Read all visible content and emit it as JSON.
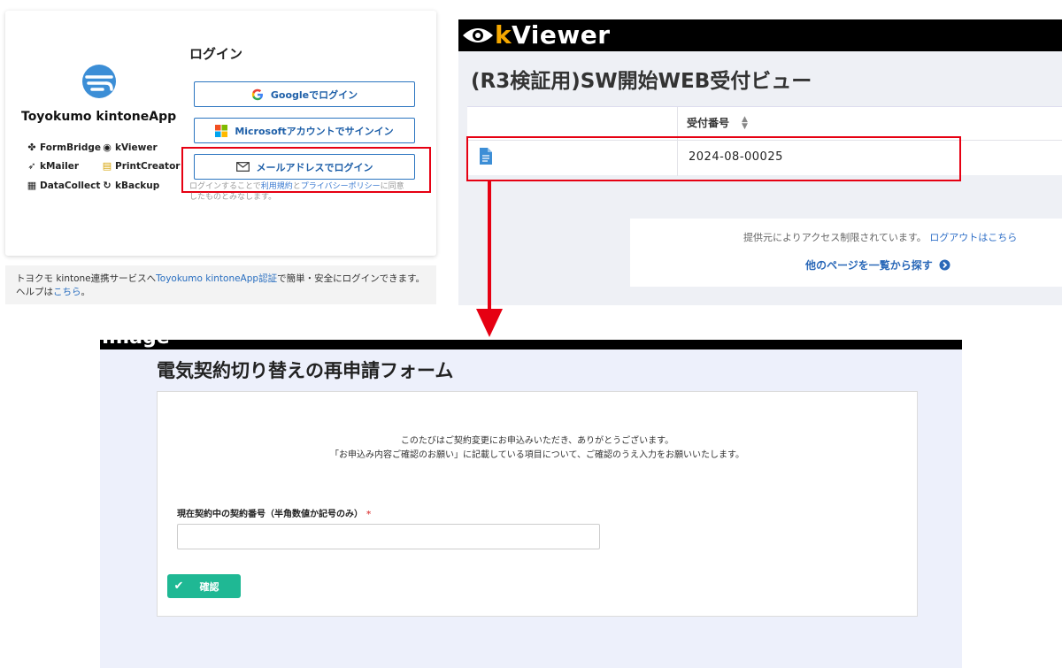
{
  "login": {
    "brand_name": "Toyokumo kintoneApp",
    "apps": [
      {
        "icon": "formbridge-icon",
        "label": "FormBridge"
      },
      {
        "icon": "kviewer-icon",
        "label": "kViewer"
      },
      {
        "icon": "kmailer-icon",
        "label": "kMailer"
      },
      {
        "icon": "printcreator-icon",
        "label": "PrintCreator"
      },
      {
        "icon": "datacollect-icon",
        "label": "DataCollect"
      },
      {
        "icon": "kbackup-icon",
        "label": "kBackup"
      }
    ],
    "title": "ログイン",
    "google_label": "Googleでログイン",
    "microsoft_label": "Microsoftアカウントでサインイン",
    "email_label": "メールアドレスでログイン",
    "note_pre": "ログインすることで",
    "note_terms": "利用規約",
    "note_mid": "と",
    "note_privacy": "プライバシーポリシー",
    "note_post": "に同意したものとみなします。",
    "footer_pre": "トヨクモ kintone連携サービスへ",
    "footer_link": "Toyokumo kintoneApp認証",
    "footer_post": "で簡単・安全にログインできます。",
    "help_pre": "ヘルプは",
    "help_link": "こちら",
    "help_post": "。"
  },
  "kviewer": {
    "logo_k": "k",
    "logo_rest": "Viewer",
    "title": "(R3検証用)SW開始WEB受付ビュー",
    "column_header": "受付番号",
    "row_value": "2024-08-00025",
    "access_msg": "提供元によりアクセス制限されています。",
    "logout_link": "ログアウトはこちら",
    "other_pages_link": "他のページを一覧から探す"
  },
  "form": {
    "header_text": "Image",
    "title": "電気契約切り替えの再申請フォーム",
    "intro_line1": "このたびはご契約変更にお申込みいただき、ありがとうございます。",
    "intro_line2": "「お申込み内容ご確認のお願い」に記載している項目について、ご確認のうえ入力をお願いいたします。",
    "field_label": "現在契約中の契約番号（半角数値か記号のみ）",
    "required_mark": "*",
    "field_value": "",
    "confirm_label": "確認"
  },
  "colors": {
    "highlight_red": "#e60012",
    "kviewer_accent": "#f5a800",
    "confirm_green": "#1fb894",
    "link_blue": "#2a68b8"
  }
}
